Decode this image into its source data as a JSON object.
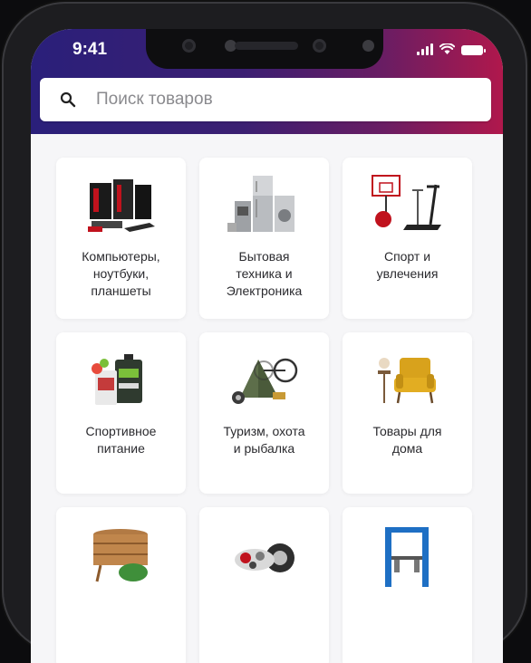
{
  "status_bar": {
    "time": "9:41"
  },
  "search": {
    "placeholder": "Поиск товаров",
    "icon": "search-icon"
  },
  "categories": [
    {
      "label": "Компьютеры,\nноутбуки,\nпланшеты",
      "icon": "computers-icon"
    },
    {
      "label": "Бытовая\nтехника и\nЭлектроника",
      "icon": "appliances-icon"
    },
    {
      "label": "Спорт и\nувлечения",
      "icon": "sports-icon"
    },
    {
      "label": "Спортивное\nпитание",
      "icon": "sports-nutrition-icon"
    },
    {
      "label": "Туризм, охота\nи рыбалка",
      "icon": "tourism-icon"
    },
    {
      "label": "Товары для\nдома",
      "icon": "home-goods-icon"
    },
    {
      "label": "",
      "icon": "garden-icon"
    },
    {
      "label": "",
      "icon": "auto-parts-icon"
    },
    {
      "label": "",
      "icon": "car-lift-icon"
    }
  ],
  "colors": {
    "header_start": "#2a1f7a",
    "header_end": "#b0184c",
    "background": "#f6f6f8"
  }
}
